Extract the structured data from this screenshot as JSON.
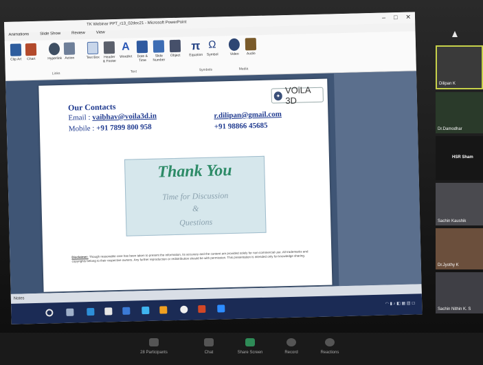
{
  "window": {
    "title": "TK Webinar PPT_r13_02dec21 - Microsoft PowerPoint",
    "controls": [
      "–",
      "□",
      "✕"
    ]
  },
  "tabs": [
    "Animations",
    "Slide Show",
    "Review",
    "View"
  ],
  "ribbon": {
    "buttons": [
      "Clip Art",
      "Chart",
      "Hyperlink",
      "Action",
      "Text Box",
      "Header & Footer",
      "WordArt",
      "Date & Time",
      "Slide Number",
      "Object",
      "Equation",
      "Symbol",
      "Video",
      "Audio"
    ],
    "groups": [
      "Links",
      "Text",
      "Symbols",
      "Media"
    ]
  },
  "slide": {
    "logo_text": "VOiLA 3D",
    "contacts_title": "Our Contacts",
    "email_label": "Email :",
    "email1": "vaibhav@voila3d.in",
    "email2": "r.dilipan@gmail.com",
    "mobile_label": "Mobile :",
    "mobile1": "+91 7899 800 958",
    "mobile2": "+91 98866 45685",
    "thanks": "Thank You",
    "disc1": "Time for Discussion",
    "disc2": "&",
    "disc3": "Questions",
    "disclaimer_label": "Disclaimer:",
    "disclaimer_text": "Though reasonable care has been taken to present the information, its accuracy and the content are provided solely for non-commercial use. All trademarks and copyrights belong to their respective owners. Any further reproduction or redistribution should be with permission. This presentation is intended only for knowledge sharing."
  },
  "status": {
    "left": "Notes"
  },
  "participants": [
    {
      "name": "Dilipan K"
    },
    {
      "name": "Dr.Damodhar"
    },
    {
      "name": "HSR Sham"
    },
    {
      "name": "Sachin Kaushik"
    },
    {
      "name": "Dr.Jyothy K"
    },
    {
      "name": "Sachin Nithin K. S"
    }
  ],
  "zoom": {
    "participants_label": "Participants",
    "participants_count": "28",
    "chat_label": "Chat",
    "share_label": "Share Screen",
    "record_label": "Record",
    "reactions_label": "Reactions"
  }
}
